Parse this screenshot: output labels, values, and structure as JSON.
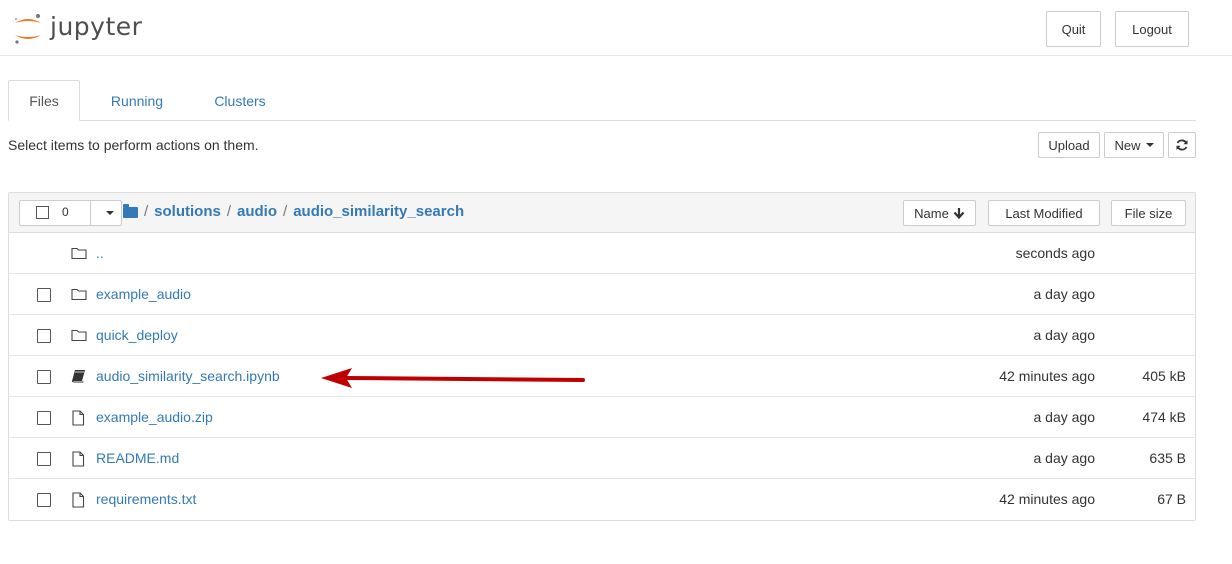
{
  "header": {
    "app_name": "jupyter",
    "quit_label": "Quit",
    "logout_label": "Logout"
  },
  "tabs": [
    {
      "label": "Files",
      "active": true
    },
    {
      "label": "Running",
      "active": false
    },
    {
      "label": "Clusters",
      "active": false
    }
  ],
  "toolbar": {
    "instructions": "Select items to perform actions on them.",
    "upload_label": "Upload",
    "new_label": "New",
    "refresh_icon": "refresh-icon"
  },
  "list_header": {
    "selected_count": "0",
    "breadcrumb": [
      "solutions",
      "audio",
      "audio_similarity_search"
    ],
    "breadcrumb_separator": "/",
    "name_label": "Name",
    "last_modified_label": "Last Modified",
    "file_size_label": "File size"
  },
  "files": [
    {
      "name": "..",
      "type": "folder",
      "modified": "seconds ago",
      "size": "",
      "checkbox": false
    },
    {
      "name": "example_audio",
      "type": "folder",
      "modified": "a day ago",
      "size": "",
      "checkbox": true
    },
    {
      "name": "quick_deploy",
      "type": "folder",
      "modified": "a day ago",
      "size": "",
      "checkbox": true
    },
    {
      "name": "audio_similarity_search.ipynb",
      "type": "notebook",
      "modified": "42 minutes ago",
      "size": "405 kB",
      "checkbox": true
    },
    {
      "name": "example_audio.zip",
      "type": "file",
      "modified": "a day ago",
      "size": "474 kB",
      "checkbox": true
    },
    {
      "name": "README.md",
      "type": "file",
      "modified": "a day ago",
      "size": "635 B",
      "checkbox": true
    },
    {
      "name": "requirements.txt",
      "type": "file",
      "modified": "42 minutes ago",
      "size": "67 B",
      "checkbox": true
    }
  ],
  "colors": {
    "link": "#337ab7",
    "annotation_arrow": "#c00000",
    "logo_orange": "#f37726"
  }
}
